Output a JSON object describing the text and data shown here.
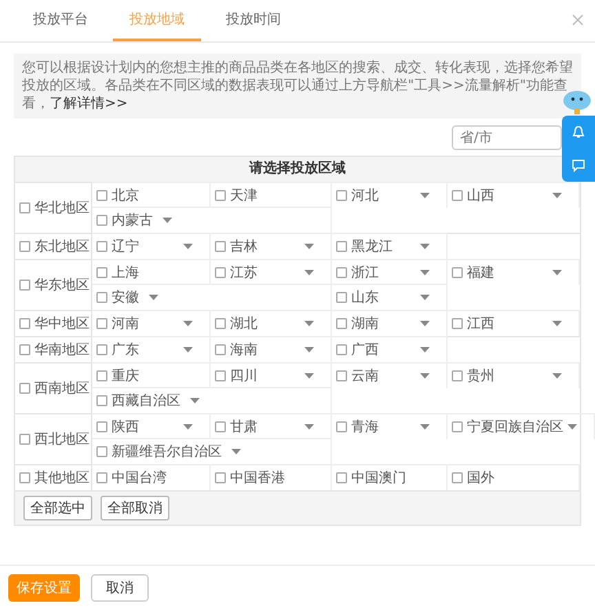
{
  "tabs": [
    {
      "label": "投放平台",
      "selected": false
    },
    {
      "label": "投放地域",
      "selected": true
    },
    {
      "label": "投放时间",
      "selected": false
    }
  ],
  "notice": {
    "text": "您可以根据设计划内的您想主推的商品品类在各地区的搜索、成交、转化表现，选择您希望投放的区域。各品类在不同区域的数据表现可以通过上方导航栏\"工具>>流量解析\"功能查看，",
    "link": "了解详情>>"
  },
  "search": {
    "placeholder": "省/市"
  },
  "table": {
    "title": "请选择投放区域",
    "regions": [
      {
        "name": "华北地区",
        "checked": false,
        "provinces": [
          {
            "name": "北京",
            "checked": false,
            "has_cities": false
          },
          {
            "name": "天津",
            "checked": false,
            "has_cities": false
          },
          {
            "name": "河北",
            "checked": false,
            "has_cities": true
          },
          {
            "name": "山西",
            "checked": false,
            "has_cities": true
          },
          {
            "name": "内蒙古",
            "checked": false,
            "has_cities": true
          }
        ]
      },
      {
        "name": "东北地区",
        "checked": false,
        "provinces": [
          {
            "name": "辽宁",
            "checked": false,
            "has_cities": true
          },
          {
            "name": "吉林",
            "checked": false,
            "has_cities": true
          },
          {
            "name": "黑龙江",
            "checked": false,
            "has_cities": true
          }
        ]
      },
      {
        "name": "华东地区",
        "checked": false,
        "provinces": [
          {
            "name": "上海",
            "checked": false,
            "has_cities": false
          },
          {
            "name": "江苏",
            "checked": false,
            "has_cities": true
          },
          {
            "name": "浙江",
            "checked": false,
            "has_cities": true
          },
          {
            "name": "福建",
            "checked": false,
            "has_cities": true
          },
          {
            "name": "安徽",
            "checked": false,
            "has_cities": true
          },
          {
            "name": "山东",
            "checked": false,
            "has_cities": true
          }
        ]
      },
      {
        "name": "华中地区",
        "checked": false,
        "provinces": [
          {
            "name": "河南",
            "checked": false,
            "has_cities": true
          },
          {
            "name": "湖北",
            "checked": false,
            "has_cities": true
          },
          {
            "name": "湖南",
            "checked": false,
            "has_cities": true
          },
          {
            "name": "江西",
            "checked": false,
            "has_cities": true
          }
        ]
      },
      {
        "name": "华南地区",
        "checked": false,
        "provinces": [
          {
            "name": "广东",
            "checked": false,
            "has_cities": true
          },
          {
            "name": "海南",
            "checked": false,
            "has_cities": true
          },
          {
            "name": "广西",
            "checked": false,
            "has_cities": true
          }
        ]
      },
      {
        "name": "西南地区",
        "checked": false,
        "provinces": [
          {
            "name": "重庆",
            "checked": false,
            "has_cities": false
          },
          {
            "name": "四川",
            "checked": false,
            "has_cities": true
          },
          {
            "name": "云南",
            "checked": false,
            "has_cities": true
          },
          {
            "name": "贵州",
            "checked": false,
            "has_cities": true
          },
          {
            "name": "西藏自治区",
            "checked": false,
            "has_cities": true
          }
        ]
      },
      {
        "name": "西北地区",
        "checked": false,
        "provinces": [
          {
            "name": "陕西",
            "checked": false,
            "has_cities": true
          },
          {
            "name": "甘肃",
            "checked": false,
            "has_cities": true
          },
          {
            "name": "青海",
            "checked": false,
            "has_cities": true
          },
          {
            "name": "宁夏回族自治区",
            "checked": false,
            "has_cities": true
          },
          {
            "name": "新疆维吾尔自治区",
            "checked": false,
            "has_cities": true
          }
        ]
      },
      {
        "name": "其他地区",
        "checked": false,
        "provinces": [
          {
            "name": "中国台湾",
            "checked": false,
            "has_cities": false
          },
          {
            "name": "中国香港",
            "checked": false,
            "has_cities": false
          },
          {
            "name": "中国澳门",
            "checked": false,
            "has_cities": false
          },
          {
            "name": "国外",
            "checked": false,
            "has_cities": false
          }
        ]
      }
    ],
    "actions": [
      "全部选中",
      "全部取消"
    ]
  },
  "footer": {
    "buttons": [
      {
        "label": "保存设置",
        "kind": "primary"
      },
      {
        "label": "取消",
        "kind": "secondary"
      }
    ]
  }
}
